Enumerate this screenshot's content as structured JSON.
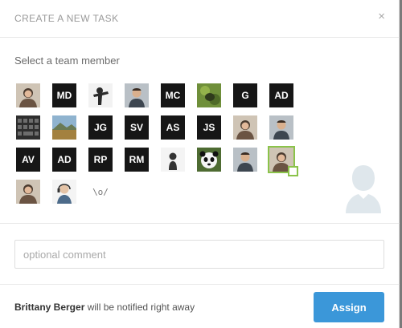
{
  "dialog": {
    "title": "CREATE A NEW TASK",
    "close_glyph": "×"
  },
  "team": {
    "label": "Select a team member",
    "members": [
      {
        "kind": "photo",
        "icon": "person-photo-woman"
      },
      {
        "kind": "initials",
        "text": "MD"
      },
      {
        "kind": "photo",
        "icon": "person-photo-pose"
      },
      {
        "kind": "photo",
        "icon": "person-photo-man"
      },
      {
        "kind": "initials",
        "text": "MC"
      },
      {
        "kind": "photo",
        "icon": "animal-photo"
      },
      {
        "kind": "initials",
        "text": "G"
      },
      {
        "kind": "initials",
        "text": "AD"
      },
      {
        "kind": "photo",
        "icon": "keyboard-photo"
      },
      {
        "kind": "photo",
        "icon": "landscape-photo"
      },
      {
        "kind": "initials",
        "text": "JG"
      },
      {
        "kind": "initials",
        "text": "SV"
      },
      {
        "kind": "initials",
        "text": "AS"
      },
      {
        "kind": "initials",
        "text": "JS"
      },
      {
        "kind": "photo",
        "icon": "person-photo-woman"
      },
      {
        "kind": "photo",
        "icon": "person-photo-man"
      },
      {
        "kind": "initials",
        "text": "AV"
      },
      {
        "kind": "initials",
        "text": "AD"
      },
      {
        "kind": "initials",
        "text": "RP"
      },
      {
        "kind": "initials",
        "text": "RM"
      },
      {
        "kind": "photo",
        "icon": "person-photo-silhouette"
      },
      {
        "kind": "photo",
        "icon": "panda-photo"
      },
      {
        "kind": "photo",
        "icon": "person-photo-man"
      },
      {
        "kind": "photo",
        "icon": "person-photo-woman",
        "selected": true
      },
      {
        "kind": "photo",
        "icon": "person-photo-woman"
      },
      {
        "kind": "photo",
        "icon": "person-photo-headset"
      },
      {
        "kind": "text",
        "text": "\\o/"
      }
    ]
  },
  "preview": {
    "icon": "user-silhouette-icon",
    "color": "#dfe7ec"
  },
  "comment": {
    "placeholder": "optional comment",
    "value": ""
  },
  "footer": {
    "assignee_name": "Brittany Berger",
    "notice_suffix": " will be notified right away",
    "assign_label": "Assign"
  },
  "colors": {
    "accent": "#3b97d9",
    "selected_border": "#8bc34a",
    "initials_bg": "#161616"
  }
}
